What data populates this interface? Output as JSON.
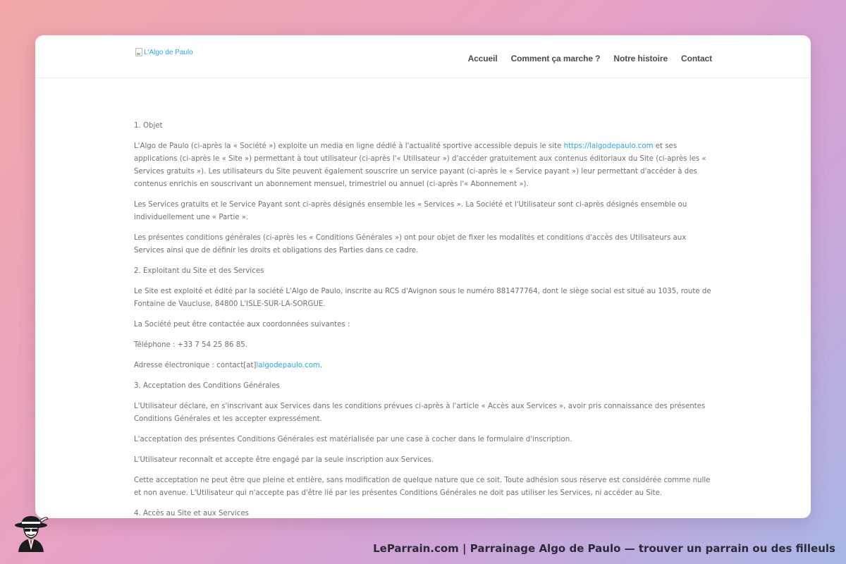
{
  "header": {
    "logo_alt": "L'Algo de Paulo",
    "nav": [
      "Accueil",
      "Comment ça marche ?",
      "Notre histoire",
      "Contact"
    ]
  },
  "content": {
    "s1_title": "1. Objet",
    "p1_a": "L'Algo de Paulo (ci-après la « Société ») exploite un media en ligne dédié à l'actualité sportive accessible depuis le site ",
    "p1_link": "https://lalgodepaulo.com",
    "p1_b": " et ses applications (ci-après le « Site ») permettant à tout utilisateur (ci-après l'« Utilisateur ») d'accéder gratuitement aux contenus éditoriaux du Site (ci-après les « Services gratuits »). Les utilisateurs du Site peuvent également souscrire un service payant (ci-après le « Service payant ») leur permettant d'accéder à des contenus enrichis en souscrivant un abonnement mensuel, trimestriel ou annuel (ci-après l'« Abonnement »).",
    "p2": "Les Services gratuits et le Service Payant sont ci-après désignés ensemble les « Services ». La Société et l'Utilisateur sont ci-après désignés ensemble ou individuellement une « Partie ».",
    "p3": "Les présentes conditions générales (ci-après les « Conditions Générales ») ont pour objet de fixer les modalités et conditions d'accès des Utilisateurs aux Services ainsi que de définir les droits et obligations des Parties dans ce cadre.",
    "s2_title": "2. Exploitant du Site et des Services",
    "p4": "Le Site est exploité et édité par la société L'Algo de Paulo, inscrite au RCS d'Avignon sous le numéro 881477764, dont le siège social est situé au 1035, route de Fontaine de Vaucluse, 84800 L'ISLE-SUR-LA-SORGUE.",
    "p5": "La Société peut être contactée aux coordonnées suivantes :",
    "p6": "Téléphone : +33 7 54 25 86 85.",
    "p7_a": "Adresse électronique : contact[at]",
    "p7_link": "lalgodepaulo.com",
    "p7_b": ".",
    "s3_title": "3. Acceptation des Conditions Générales",
    "p8": "L'Utilisateur déclare, en s'inscrivant aux Services dans les conditions prévues ci-après à l'article « Accès aux Services », avoir pris connaissance des présentes Conditions Générales et les accepter expressément.",
    "p9": "L'acceptation des présentes Conditions Générales est matérialisée par une case à cocher dans le formulaire d'inscription.",
    "p10": "L'Utilisateur reconnaît et accepte être engagé par la seule inscription aux Services.",
    "p11": "Cette acceptation ne peut être que pleine et entière, sans modification de quelque nature que ce soit. Toute adhésion sous réserve est considérée comme nulle et non avenue. L'Utilisateur qui n'accepte pas d'être lié par les présentes Conditions Générales ne doit pas utiliser les Services, ni accéder au Site.",
    "s4_title": "4. Accès au Site et aux Services"
  },
  "footer": {
    "caption": "LeParrain.com | Parrainage Algo de Paulo — trouver un parrain ou des filleuls",
    "mascot_icon": "godfather-mascot-icon"
  },
  "colors": {
    "link": "#2ea3f2",
    "body_text": "#707070",
    "nav_text": "#4c4c4c"
  }
}
